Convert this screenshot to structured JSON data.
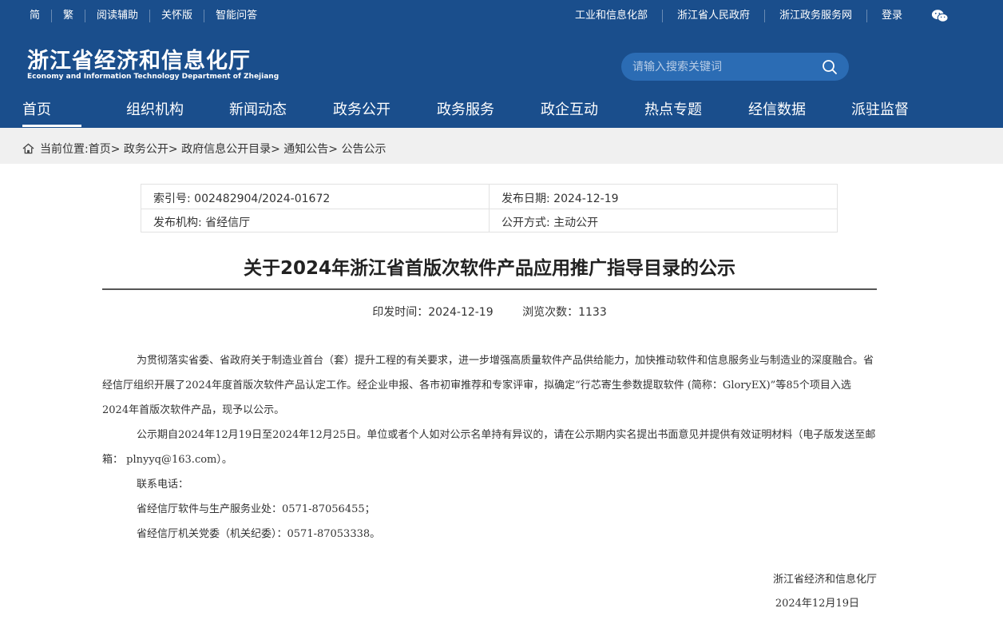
{
  "topbar": {
    "left": [
      "简",
      "繁",
      "阅读辅助",
      "关怀版",
      "智能问答"
    ],
    "right": [
      "工业和信息化部",
      "浙江省人民政府",
      "浙江政务服务网"
    ],
    "login": "登录"
  },
  "logo": {
    "cn": "浙江省经济和信息化厅",
    "en": "Economy and Information Technology Department of Zhejiang"
  },
  "search": {
    "placeholder": "请输入搜索关键词"
  },
  "nav": [
    "首页",
    "组织机构",
    "新闻动态",
    "政务公开",
    "政务服务",
    "政企互动",
    "热点专题",
    "经信数据",
    "派驻监督"
  ],
  "breadcrumb": {
    "label": "当前位置:",
    "path": "首页> 政务公开> 政府信息公开目录> 通知公告> 公告公示"
  },
  "meta": {
    "index": "索引号: 002482904/2024-01672",
    "publish_date": "发布日期: 2024-12-19",
    "org": "发布机构: 省经信厅",
    "mode": "公开方式: 主动公开"
  },
  "article": {
    "title": "关于2024年浙江省首版次软件产品应用推广指导目录的公示",
    "issue_time": "印发时间：2024-12-19",
    "views": "浏览次数：1133",
    "paragraphs": [
      "为贯彻落实省委、省政府关于制造业首台（套）提升工程的有关要求，进一步增强高质量软件产品供给能力，加快推动软件和信息服务业与制造业的深度融合。省经信厅组织开展了2024年度首版次软件产品认定工作。经企业申报、各市初审推荐和专家评审，拟确定“行芯寄生参数提取软件 (简称：GloryEX)”等85个项目入选2024年首版次软件产品，现予以公示。",
      "公示期自2024年12月19日至2024年12月25日。单位或者个人如对公示名单持有异议的，请在公示期内实名提出书面意见并提供有效证明材料（电子版发送至邮箱： plnyyq@163.com）。"
    ],
    "contact_label": "联系电话：",
    "contacts": [
      "省经信厅软件与生产服务业处：0571-87056455；",
      "省经信厅机关党委（机关纪委）：0571-87053338。"
    ],
    "signature": "浙江省经济和信息化厅",
    "sign_date": "2024年12月19日"
  },
  "colors": {
    "header_bg": "#1a4e8c",
    "search_bg": "#2b6cb4",
    "crumb_bg": "#f0f0f0"
  }
}
